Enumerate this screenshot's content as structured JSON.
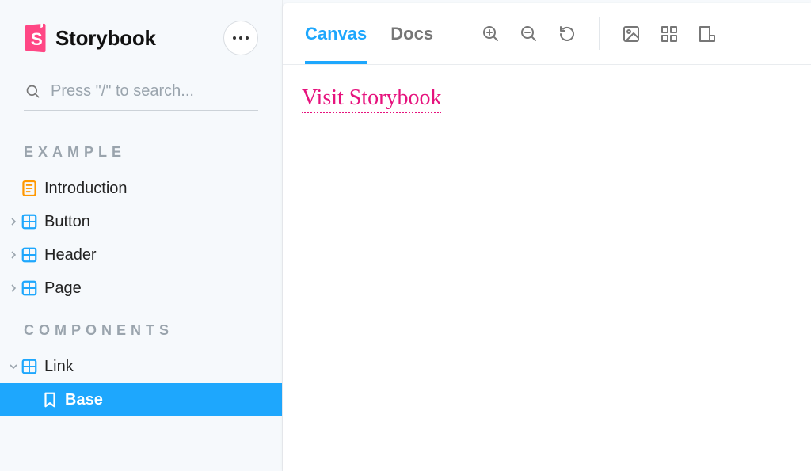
{
  "brand": {
    "name": "Storybook"
  },
  "search": {
    "placeholder": "Press \"/\" to search..."
  },
  "sidebar": {
    "sections": [
      {
        "title": "EXAMPLE",
        "items": [
          {
            "label": "Introduction",
            "icon": "document-icon",
            "expandable": false
          },
          {
            "label": "Button",
            "icon": "component-icon",
            "expandable": true
          },
          {
            "label": "Header",
            "icon": "component-icon",
            "expandable": true
          },
          {
            "label": "Page",
            "icon": "component-icon",
            "expandable": true
          }
        ]
      },
      {
        "title": "COMPONENTS",
        "items": [
          {
            "label": "Link",
            "icon": "component-icon",
            "expandable": true,
            "expanded": true,
            "children": [
              {
                "label": "Base",
                "icon": "bookmark-icon",
                "active": true
              }
            ]
          }
        ]
      }
    ]
  },
  "toolbar": {
    "tabs": [
      {
        "label": "Canvas",
        "active": true
      },
      {
        "label": "Docs",
        "active": false
      }
    ],
    "icons_group1": [
      "zoom-in-icon",
      "zoom-out-icon",
      "reset-icon"
    ],
    "icons_group2": [
      "background-icon",
      "grid-icon",
      "measure-icon"
    ]
  },
  "canvas": {
    "link_text": "Visit Storybook"
  }
}
